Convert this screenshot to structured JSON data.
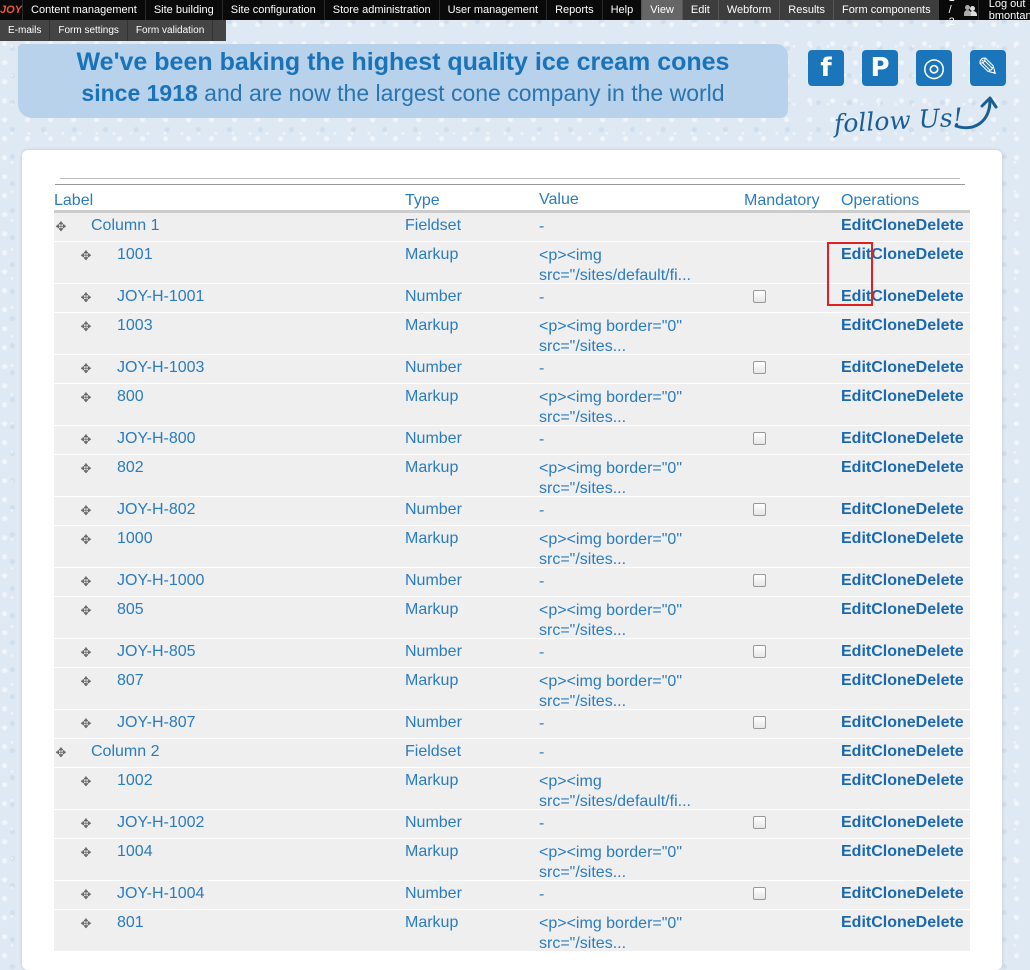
{
  "toolbar": {
    "logo": "JOY",
    "items": [
      "Content management",
      "Site building",
      "Site configuration",
      "Store administration",
      "User management",
      "Reports",
      "Help"
    ],
    "tabs": [
      "View",
      "Edit",
      "Webform",
      "Results",
      "Form components"
    ],
    "active_tab": "View",
    "counter": "1 / 2",
    "logout": "Log out bmontana"
  },
  "subtoolbar": [
    "E-mails",
    "Form settings",
    "Form validation"
  ],
  "banner": {
    "line1": "We've been baking the highest quality ice cream cones",
    "line2_bold": "since 1918",
    "line2_rest": " and are now the largest cone company in the world"
  },
  "social": {
    "icons": [
      "facebook-icon",
      "pinterest-icon",
      "instagram-icon",
      "newsletter-icon"
    ],
    "glyphs": [
      "f",
      "P",
      "◎",
      "✎"
    ],
    "follow": "follow Us!"
  },
  "table": {
    "headers": {
      "label": "Label",
      "type": "Type",
      "value": "Value",
      "mandatory": "Mandatory",
      "operations": "Operations"
    },
    "ops": {
      "edit": "Edit",
      "clone": "Clone",
      "delete": "Delete"
    },
    "rows": [
      {
        "level": 0,
        "label": "Column 1",
        "type": "Fieldset",
        "value": "-",
        "mandatory": false
      },
      {
        "level": 1,
        "label": "1001",
        "type": "Markup",
        "value": "<p><img src=\"/sites/default/fi...",
        "mandatory": false
      },
      {
        "level": 1,
        "label": "JOY-H-1001",
        "type": "Number",
        "value": "-",
        "mandatory": true
      },
      {
        "level": 1,
        "label": "1003",
        "type": "Markup",
        "value": "<p><img border=\"0\" src=\"/sites...",
        "mandatory": false
      },
      {
        "level": 1,
        "label": "JOY-H-1003",
        "type": "Number",
        "value": "-",
        "mandatory": true
      },
      {
        "level": 1,
        "label": "800",
        "type": "Markup",
        "value": "<p><img border=\"0\" src=\"/sites...",
        "mandatory": false
      },
      {
        "level": 1,
        "label": "JOY-H-800",
        "type": "Number",
        "value": "-",
        "mandatory": true
      },
      {
        "level": 1,
        "label": "802",
        "type": "Markup",
        "value": "<p><img border=\"0\" src=\"/sites...",
        "mandatory": false
      },
      {
        "level": 1,
        "label": "JOY-H-802",
        "type": "Number",
        "value": "-",
        "mandatory": true
      },
      {
        "level": 1,
        "label": "1000",
        "type": "Markup",
        "value": "<p><img border=\"0\" src=\"/sites...",
        "mandatory": false
      },
      {
        "level": 1,
        "label": "JOY-H-1000",
        "type": "Number",
        "value": "-",
        "mandatory": true
      },
      {
        "level": 1,
        "label": "805",
        "type": "Markup",
        "value": "<p><img border=\"0\" src=\"/sites...",
        "mandatory": false
      },
      {
        "level": 1,
        "label": "JOY-H-805",
        "type": "Number",
        "value": "-",
        "mandatory": true
      },
      {
        "level": 1,
        "label": "807",
        "type": "Markup",
        "value": "<p><img border=\"0\" src=\"/sites...",
        "mandatory": false
      },
      {
        "level": 1,
        "label": "JOY-H-807",
        "type": "Number",
        "value": "-",
        "mandatory": true
      },
      {
        "level": 0,
        "label": "Column 2",
        "type": "Fieldset",
        "value": "-",
        "mandatory": false
      },
      {
        "level": 1,
        "label": "1002",
        "type": "Markup",
        "value": "<p><img src=\"/sites/default/fi...",
        "mandatory": false
      },
      {
        "level": 1,
        "label": "JOY-H-1002",
        "type": "Number",
        "value": "-",
        "mandatory": true
      },
      {
        "level": 1,
        "label": "1004",
        "type": "Markup",
        "value": "<p><img border=\"0\" src=\"/sites...",
        "mandatory": false
      },
      {
        "level": 1,
        "label": "JOY-H-1004",
        "type": "Number",
        "value": "-",
        "mandatory": true
      },
      {
        "level": 1,
        "label": "801",
        "type": "Markup",
        "value": "<p><img border=\"0\" src=\"/sites...",
        "mandatory": false
      }
    ]
  }
}
